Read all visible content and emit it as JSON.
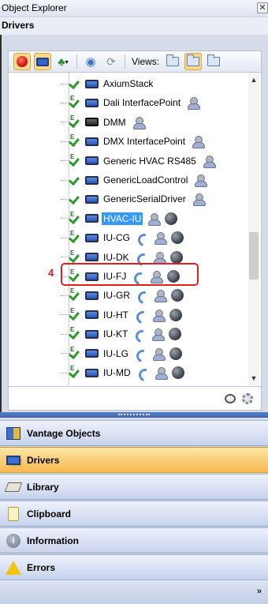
{
  "window": {
    "title": "Object Explorer",
    "close_glyph": "✕"
  },
  "section": {
    "title": "Drivers"
  },
  "toolbar": {
    "views_label": "Views:",
    "buttons": [
      "red-dot-icon",
      "drivers-icon",
      "plant-icon",
      "globe-icon",
      "refresh-icon",
      "folder-icon",
      "folder-view-icon",
      "folder-view-alt-icon"
    ]
  },
  "tree": {
    "items": [
      {
        "label": "AxiumStack",
        "selected": false
      },
      {
        "label": "Dali InterfacePoint",
        "selected": false
      },
      {
        "label": "DMM",
        "selected": false
      },
      {
        "label": "DMX InterfacePoint",
        "selected": false
      },
      {
        "label": "Generic HVAC RS485",
        "selected": false
      },
      {
        "label": "GenericLoadControl",
        "selected": false
      },
      {
        "label": "GenericSerialDriver",
        "selected": false
      },
      {
        "label": "HVAC-IU",
        "selected": true
      },
      {
        "label": "IU-CG",
        "selected": false
      },
      {
        "label": "IU-DK",
        "selected": false
      },
      {
        "label": "IU-FJ",
        "selected": false
      },
      {
        "label": "IU-GR",
        "selected": false
      },
      {
        "label": "IU-HT",
        "selected": false
      },
      {
        "label": "IU-KT",
        "selected": false
      },
      {
        "label": "IU-LG",
        "selected": false
      },
      {
        "label": "IU-MD",
        "selected": false
      }
    ],
    "callout": "4"
  },
  "nav": {
    "items": [
      {
        "label": "Vantage Objects",
        "icon": "vantage-objects-icon",
        "active": false
      },
      {
        "label": "Drivers",
        "icon": "drivers-icon",
        "active": true
      },
      {
        "label": "Library",
        "icon": "library-icon",
        "active": false
      },
      {
        "label": "Clipboard",
        "icon": "clipboard-icon",
        "active": false
      },
      {
        "label": "Information",
        "icon": "information-icon",
        "active": false
      },
      {
        "label": "Errors",
        "icon": "warning-icon",
        "active": false
      }
    ],
    "more_glyph": "»"
  },
  "colors": {
    "selected_bg": "#3399ff",
    "callout_red": "#e02020",
    "active_nav": "#f6b94e"
  }
}
